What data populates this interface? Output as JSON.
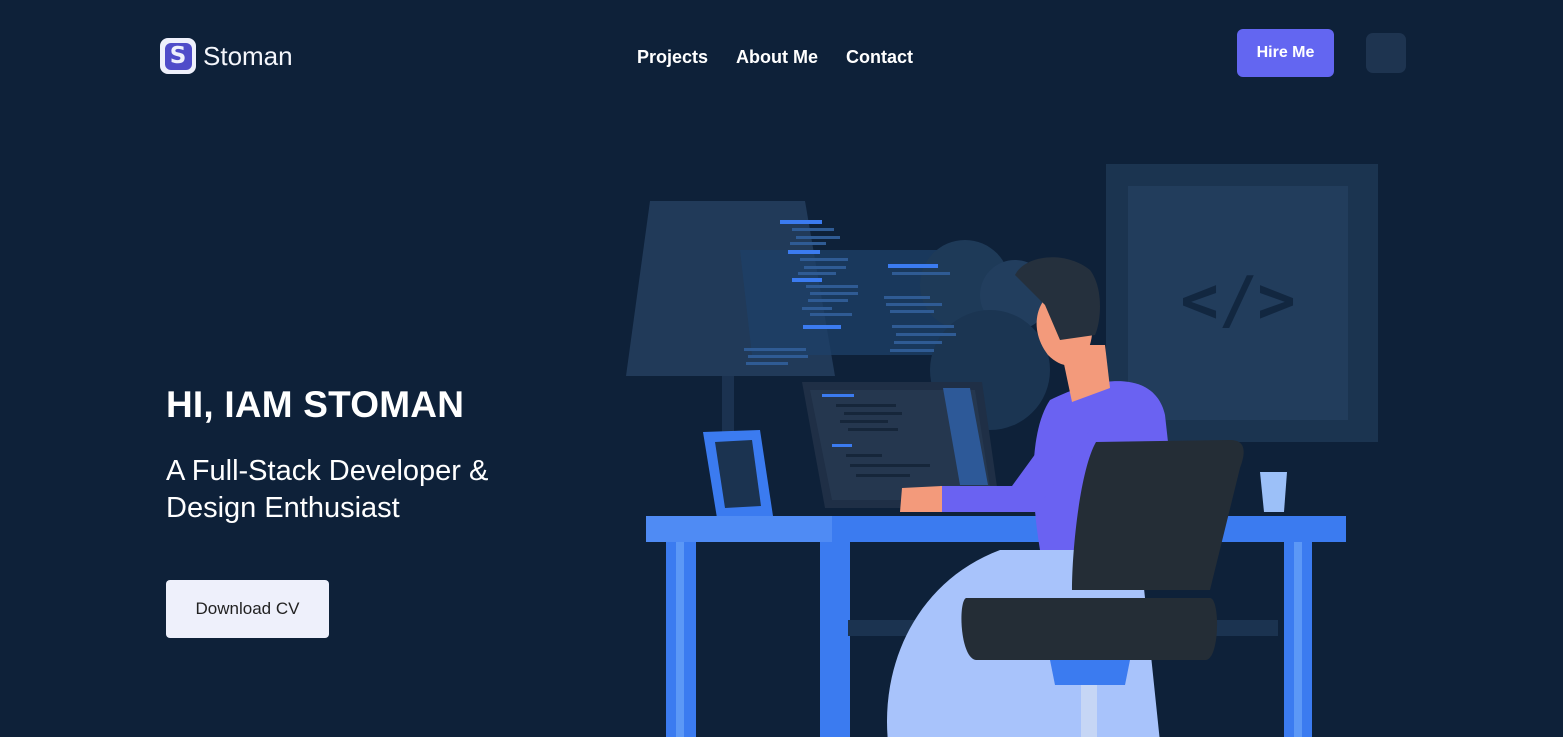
{
  "brand": {
    "logo_letter": "S",
    "name": "Stoman"
  },
  "nav": {
    "items": [
      {
        "label": "Projects"
      },
      {
        "label": "About Me"
      },
      {
        "label": "Contact"
      }
    ]
  },
  "header": {
    "hire_label": "Hire Me",
    "toggle_icon": "theme-toggle-icon"
  },
  "hero": {
    "title": "HI, IAM STOMAN",
    "subtitle": "A Full-Stack Developer & Design Enthusiast",
    "cta_label": "Download CV"
  },
  "illustration": {
    "monitor_symbol": "</>"
  },
  "colors": {
    "background": "#0e2139",
    "accent": "#6366f1",
    "desk_blue": "#3b7bf0",
    "shirt_purple": "#6a62f2",
    "button_light": "#eef0fb"
  }
}
